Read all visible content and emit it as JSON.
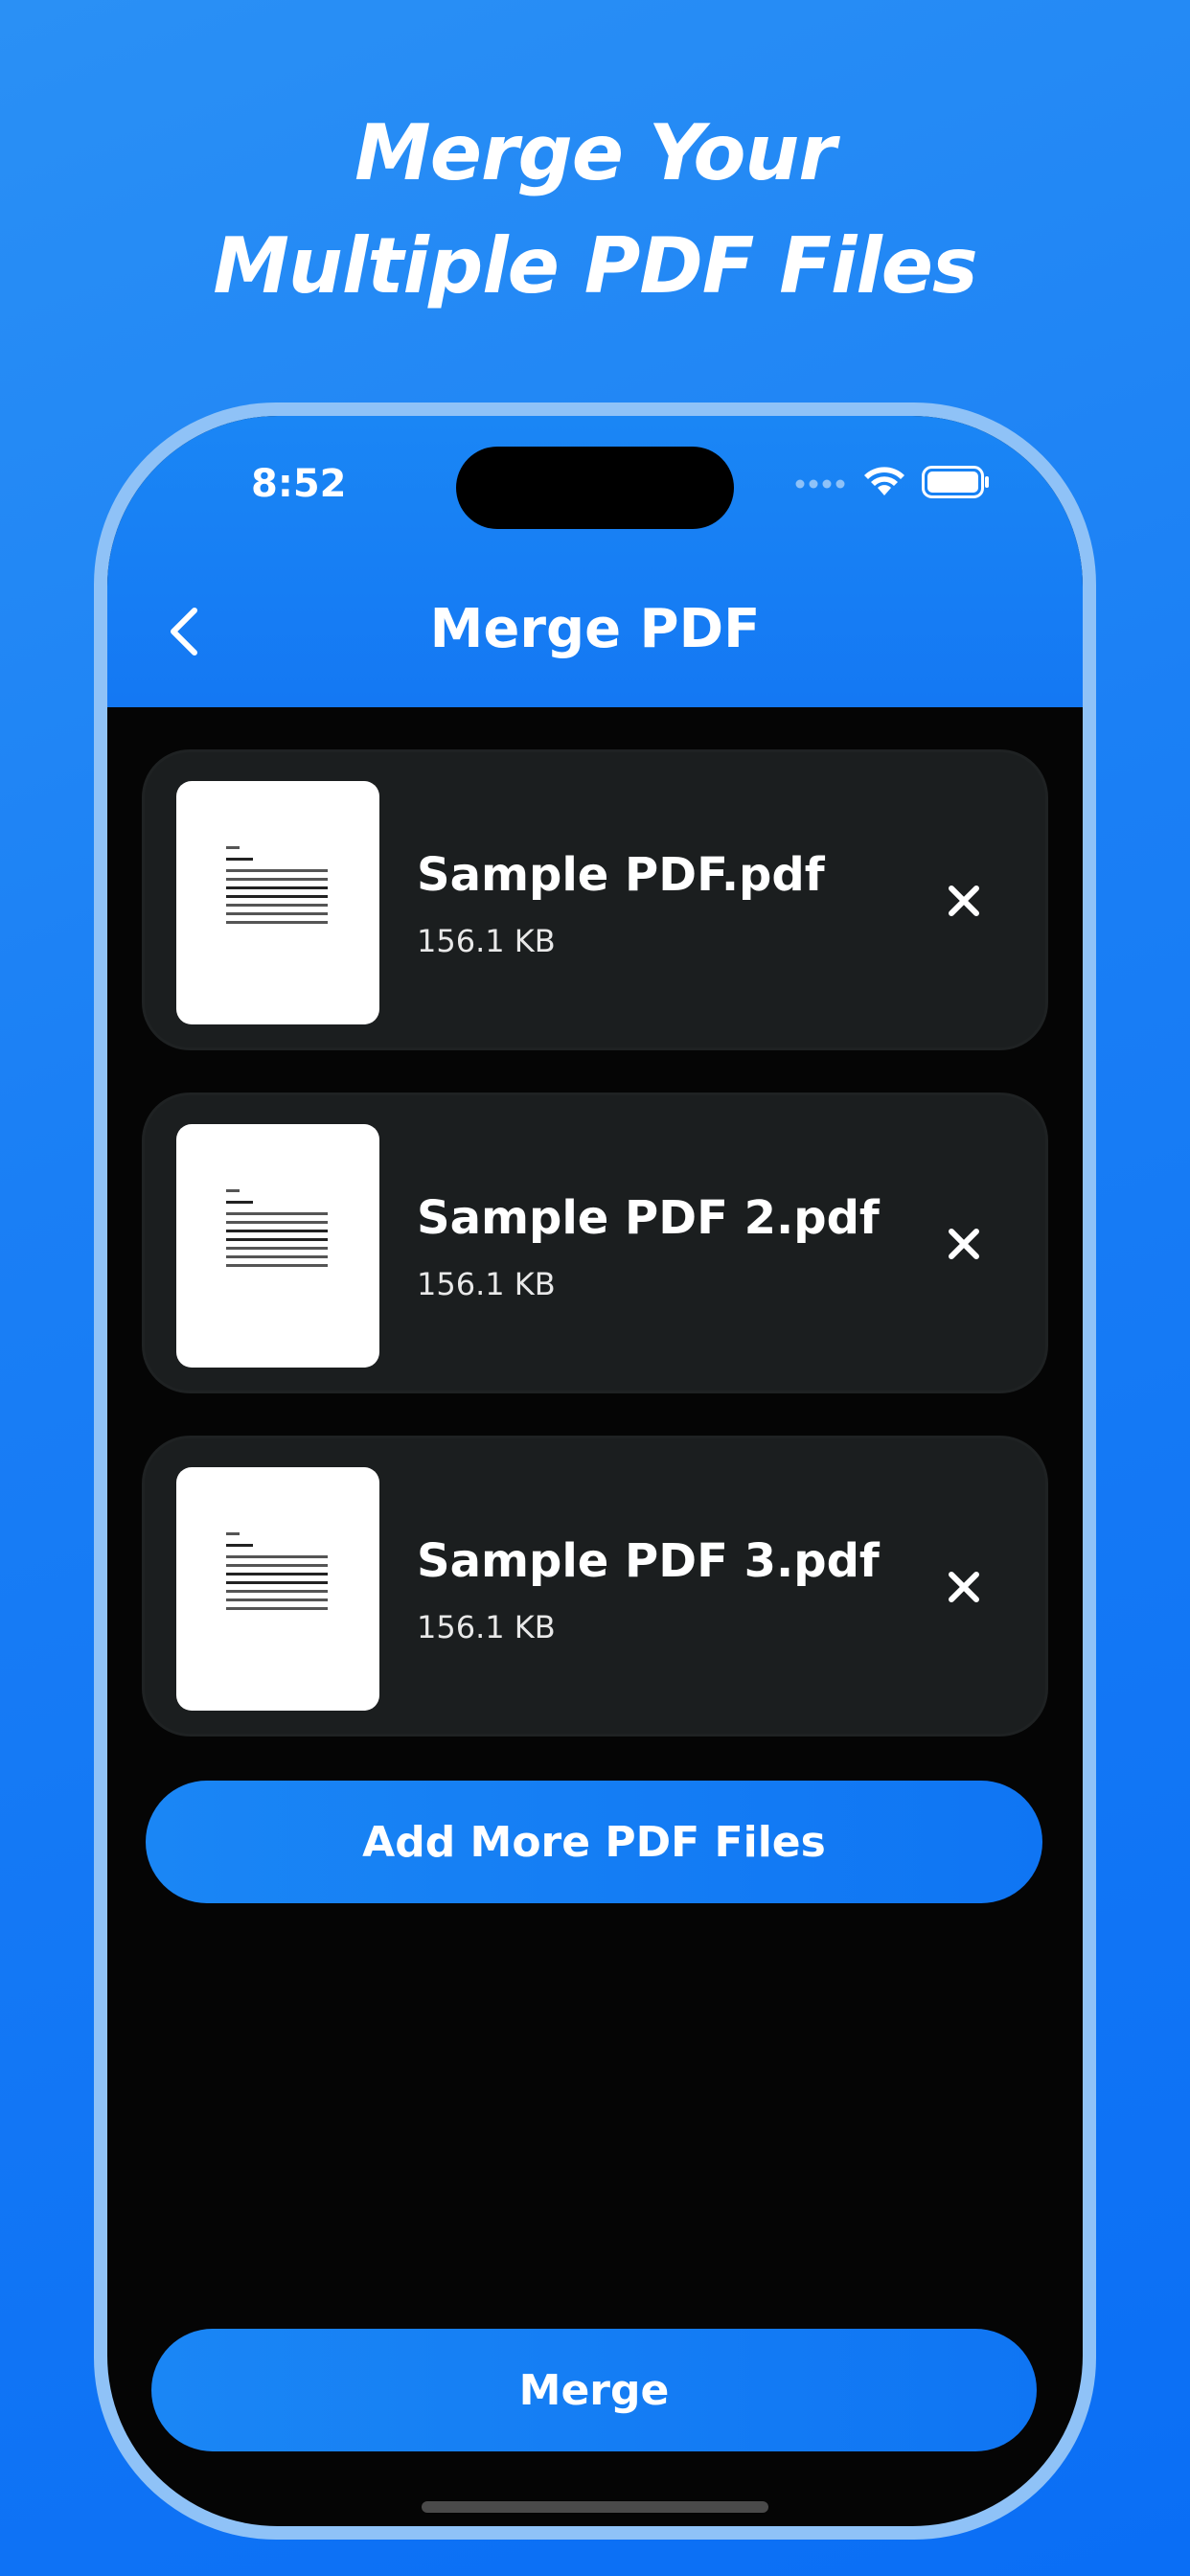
{
  "promo": {
    "line1": "Merge Your",
    "line2": "Multiple PDF Files"
  },
  "status_bar": {
    "time": "8:52",
    "icons": [
      "signal-icon",
      "wifi-icon",
      "battery-icon"
    ]
  },
  "nav": {
    "title": "Merge PDF",
    "back_icon": "chevron-left-icon"
  },
  "files": [
    {
      "name": "Sample PDF.pdf",
      "size": "156.1 KB"
    },
    {
      "name": "Sample PDF 2.pdf",
      "size": "156.1 KB"
    },
    {
      "name": "Sample PDF 3.pdf",
      "size": "156.1 KB"
    }
  ],
  "actions": {
    "add_more": "Add More PDF Files",
    "merge": "Merge"
  },
  "colors": {
    "accent": "#1478F3",
    "card": "#1B1E1F",
    "screen_bg": "#050505",
    "frame": "#8FC2F7"
  }
}
